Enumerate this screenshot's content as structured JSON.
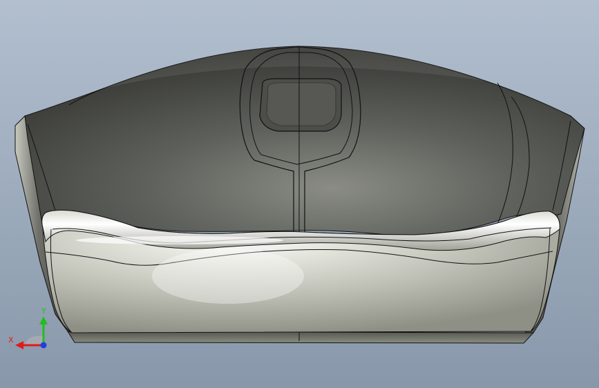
{
  "viewport": {
    "background_top": "#b2bfcf",
    "background_bottom": "#8898aa"
  },
  "model": {
    "name_icon": "computer-mouse-model",
    "shell_dark": "#3f403c",
    "shell_mid": "#6f716b",
    "shell_light": "#8c8e87",
    "skirt_light": "#f2f3ee",
    "skirt_mid": "#c9cbc1",
    "skirt_dark": "#8d8f83",
    "edge_color": "#111111"
  },
  "triad": {
    "x_label": "X",
    "y_label": "Y",
    "x_color": "#e01b1b",
    "y_color": "#1fbf1f",
    "z_color": "#1f3fe0"
  }
}
